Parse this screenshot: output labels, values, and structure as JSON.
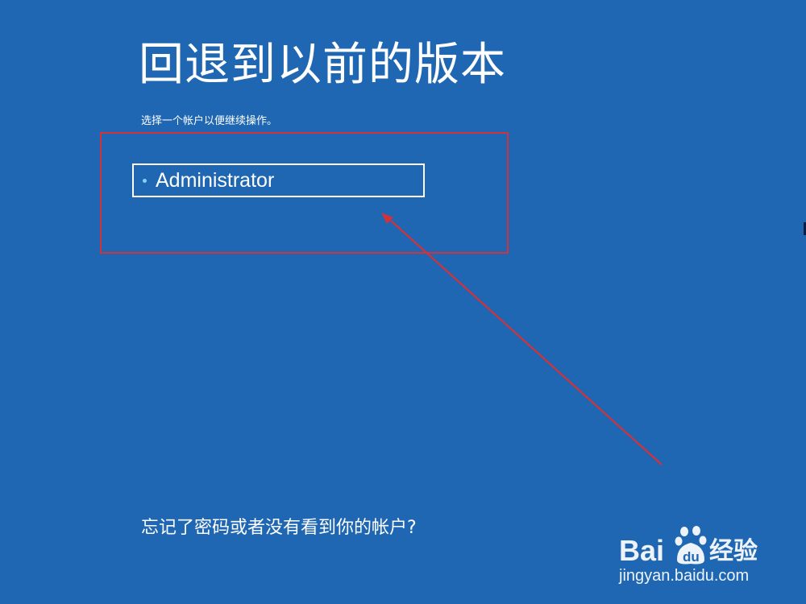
{
  "screen": {
    "title": "回退到以前的版本",
    "subtitle": "选择一个帐户以便继续操作。",
    "forgot_link": "忘记了密码或者没有看到你的帐户?"
  },
  "accounts": [
    {
      "name": "Administrator"
    }
  ],
  "annotation": {
    "highlight_color": "#d2323a",
    "arrow_color": "#d2323a"
  },
  "watermark": {
    "logo_text": "Bai du 经验",
    "url": "jingyan.baidu.com"
  },
  "colors": {
    "background": "#1f67b2",
    "text": "#ffffff",
    "bullet": "#7fd3ff"
  }
}
